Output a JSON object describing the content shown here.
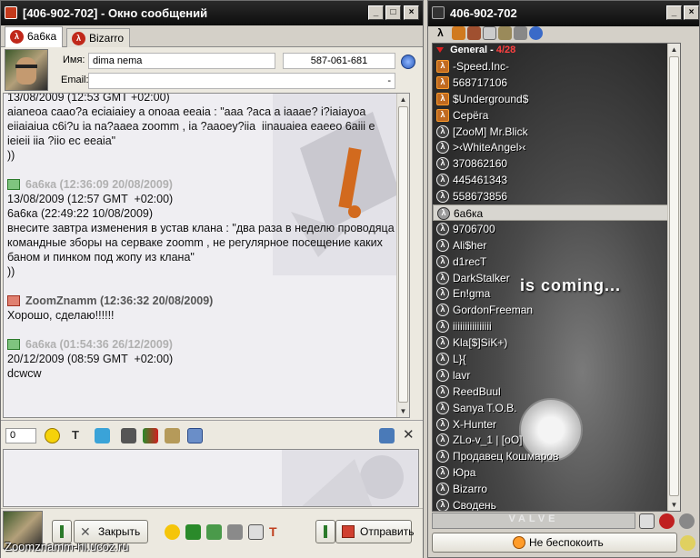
{
  "message_window": {
    "title": "[406-902-702] - Окно сообщений",
    "tabs": [
      {
        "label": "6а6ка",
        "active": true
      },
      {
        "label": "Bizarro",
        "active": false
      }
    ],
    "info": {
      "name_label": "Имя:",
      "name_value": "dima  nema",
      "uin_value": "587-061-681",
      "email_label": "Email:",
      "email_value": "-"
    },
    "messages": [
      {
        "header": "",
        "direction": "in",
        "lines": [
          "13/08/2009 (12:53 GMT +02:00)",
          "aianeoa caao?a eciaiaiey a onoaa eeaia : \"aaa ?aca a iaaae? i?iaiayoa eiiaiaiua c6i?u ia na?aaea zoomm , ia ?aaoey?iia  iinauaiea eaeeo 6aiii e ieieii iia ?iio ec eeaia\"",
          "))"
        ]
      },
      {
        "header": "6а6ка (12:36:09 20/08/2009)",
        "direction": "in",
        "lines": [
          "13/08/2009 (12:57 GMT  +02:00)",
          "6а6ка (22:49:22 10/08/2009)",
          "внесите завтра изменения в устав клана : \"два раза в неделю проводяца командные зборы на серваке zoomm , не регулярное посещение каких баном и пинком под жопу из клана\"",
          "))"
        ]
      },
      {
        "header": "ZoomZnamm (12:36:32 20/08/2009)",
        "direction": "out",
        "lines": [
          "Хорошо, сделаю!!!!!!"
        ]
      },
      {
        "header": "6а6ка (01:54:36 26/12/2009)",
        "direction": "in",
        "lines": [
          "20/12/2009 (08:59 GMT  +02:00)",
          "dcwcw"
        ]
      }
    ],
    "toolbar": {
      "char_count": "0"
    },
    "footer_url": "Zoomznamm-hl.ucoz.ru",
    "buttons": {
      "close": "Закрыть",
      "send": "Отправить"
    }
  },
  "contact_list": {
    "title": "406-902-702",
    "group": {
      "name": "General",
      "count": "4/28"
    },
    "contacts": [
      {
        "name": "-Speed.Inc-",
        "icon": "special"
      },
      {
        "name": "568717106",
        "icon": "special"
      },
      {
        "name": "$Underground$",
        "icon": "special"
      },
      {
        "name": "Серёга",
        "icon": "special"
      },
      {
        "name": "[ZooM] Mr.Blick",
        "icon": "lambda"
      },
      {
        "name": ">‹WhiteAngel›‹",
        "icon": "lambda"
      },
      {
        "name": "370862160",
        "icon": "lambda"
      },
      {
        "name": "445461343",
        "icon": "lambda"
      },
      {
        "name": "558673856",
        "icon": "lambda"
      },
      {
        "name": "6а6ка",
        "icon": "lambda",
        "selected": true
      },
      {
        "name": "9706700",
        "icon": "lambda"
      },
      {
        "name": "Ali$her",
        "icon": "lambda"
      },
      {
        "name": "d1recT",
        "icon": "lambda"
      },
      {
        "name": "DarkStalker",
        "icon": "lambda"
      },
      {
        "name": "En!gma",
        "icon": "lambda"
      },
      {
        "name": "GordonFreeman",
        "icon": "lambda"
      },
      {
        "name": "iiiiiiiiiiiiiiii",
        "icon": "lambda"
      },
      {
        "name": "Kla[$]SiK+)",
        "icon": "lambda"
      },
      {
        "name": "L}{",
        "icon": "lambda"
      },
      {
        "name": "lavr",
        "icon": "lambda"
      },
      {
        "name": "ReedBuul",
        "icon": "lambda"
      },
      {
        "name": "Sanya T.O.B.",
        "icon": "lambda"
      },
      {
        "name": "X-Hunter",
        "icon": "lambda"
      },
      {
        "name": "ZLo-v_1 | [oO]",
        "icon": "lambda"
      },
      {
        "name": "Продавец Кошмаров",
        "icon": "lambda"
      },
      {
        "name": "Юра",
        "icon": "lambda"
      },
      {
        "name": "Bizarro",
        "icon": "lambda"
      },
      {
        "name": "Сводень",
        "icon": "lambda"
      }
    ],
    "promo_text": "is coming...",
    "status_bar_text": "VALVE",
    "status_button": "Не беспокоить"
  }
}
